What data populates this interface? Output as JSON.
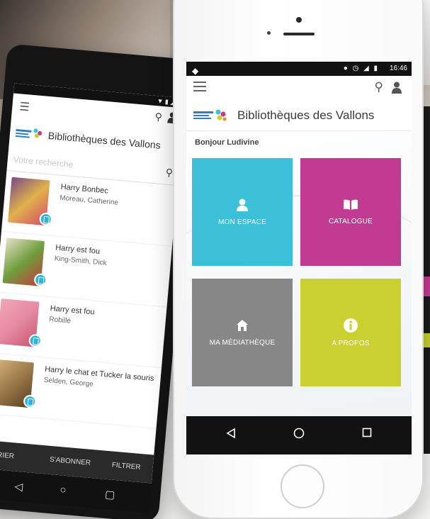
{
  "left_phone": {
    "brand_title": "Bibliothèques des Vallons",
    "search_placeholder": "Votre recherche",
    "results": [
      {
        "title": "Harry Bonbec",
        "author": "Moreau, Catherine",
        "cover_color": "#7a4a8a"
      },
      {
        "title": "Harry est fou",
        "author": "King-Smith, Dick",
        "cover_color": "#6e9e3e"
      },
      {
        "title": "Harry est fou",
        "author": "Robillé",
        "cover_color": "#e58aa3"
      },
      {
        "title": "Harry le chat et Tucker la souris",
        "author": "Selden, George",
        "cover_color": "#9a7a4a"
      }
    ],
    "actions": {
      "sort": "↑ TRIER",
      "subscribe": "S'ABONNER",
      "filter": "FILTRER"
    }
  },
  "main_phone": {
    "status": {
      "time": "16:46"
    },
    "brand_title": "Bibliothèques des Vallons",
    "greeting": "Bonjour Ludivine",
    "tiles": [
      {
        "label": "MON ESPACE",
        "icon": "user-icon",
        "color": "#3cc0d9"
      },
      {
        "label": "CATALOGUE",
        "icon": "book-icon",
        "color": "#c13b92"
      },
      {
        "label": "MA MÉDIATHÈQUE",
        "icon": "house-icon",
        "color": "#878787"
      },
      {
        "label": "A PROPOS",
        "icon": "info-icon",
        "color": "#c9d030"
      }
    ],
    "nav": [
      "back-icon",
      "home-icon",
      "recents-icon"
    ]
  }
}
